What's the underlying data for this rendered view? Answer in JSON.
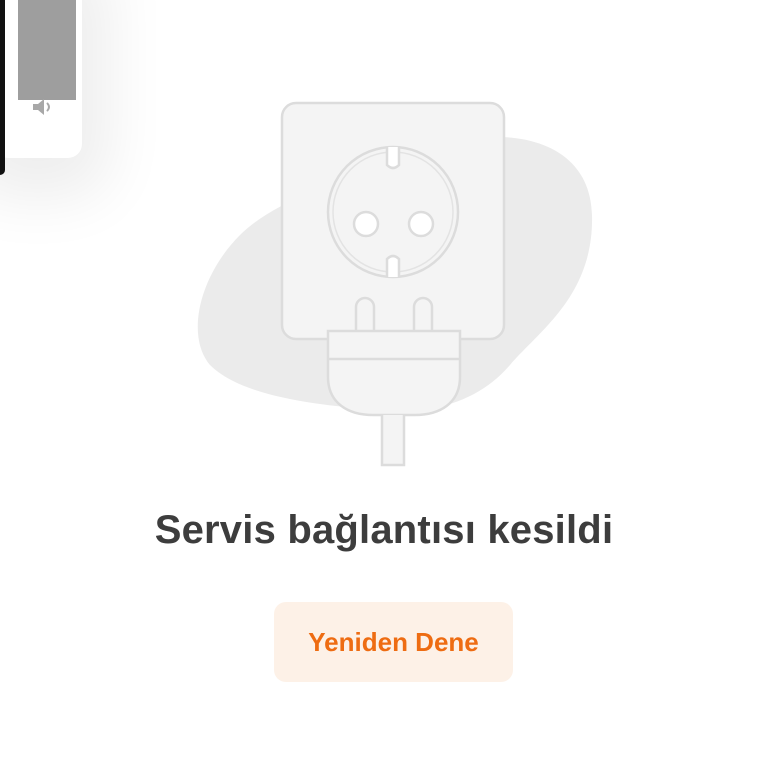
{
  "volume_overlay": {
    "icon": "speaker-icon",
    "level_percent": 80
  },
  "illustration": {
    "icon": "unplugged-socket-icon"
  },
  "error": {
    "title": "Servis bağlantısı kesildi"
  },
  "actions": {
    "retry_label": "Yeniden Dene"
  },
  "colors": {
    "accent": "#ee6c12",
    "button_bg": "#fdf1e7",
    "title": "#3d3d3d",
    "illustration_stroke": "#dcdcdc",
    "illustration_blob": "#ebebeb"
  }
}
